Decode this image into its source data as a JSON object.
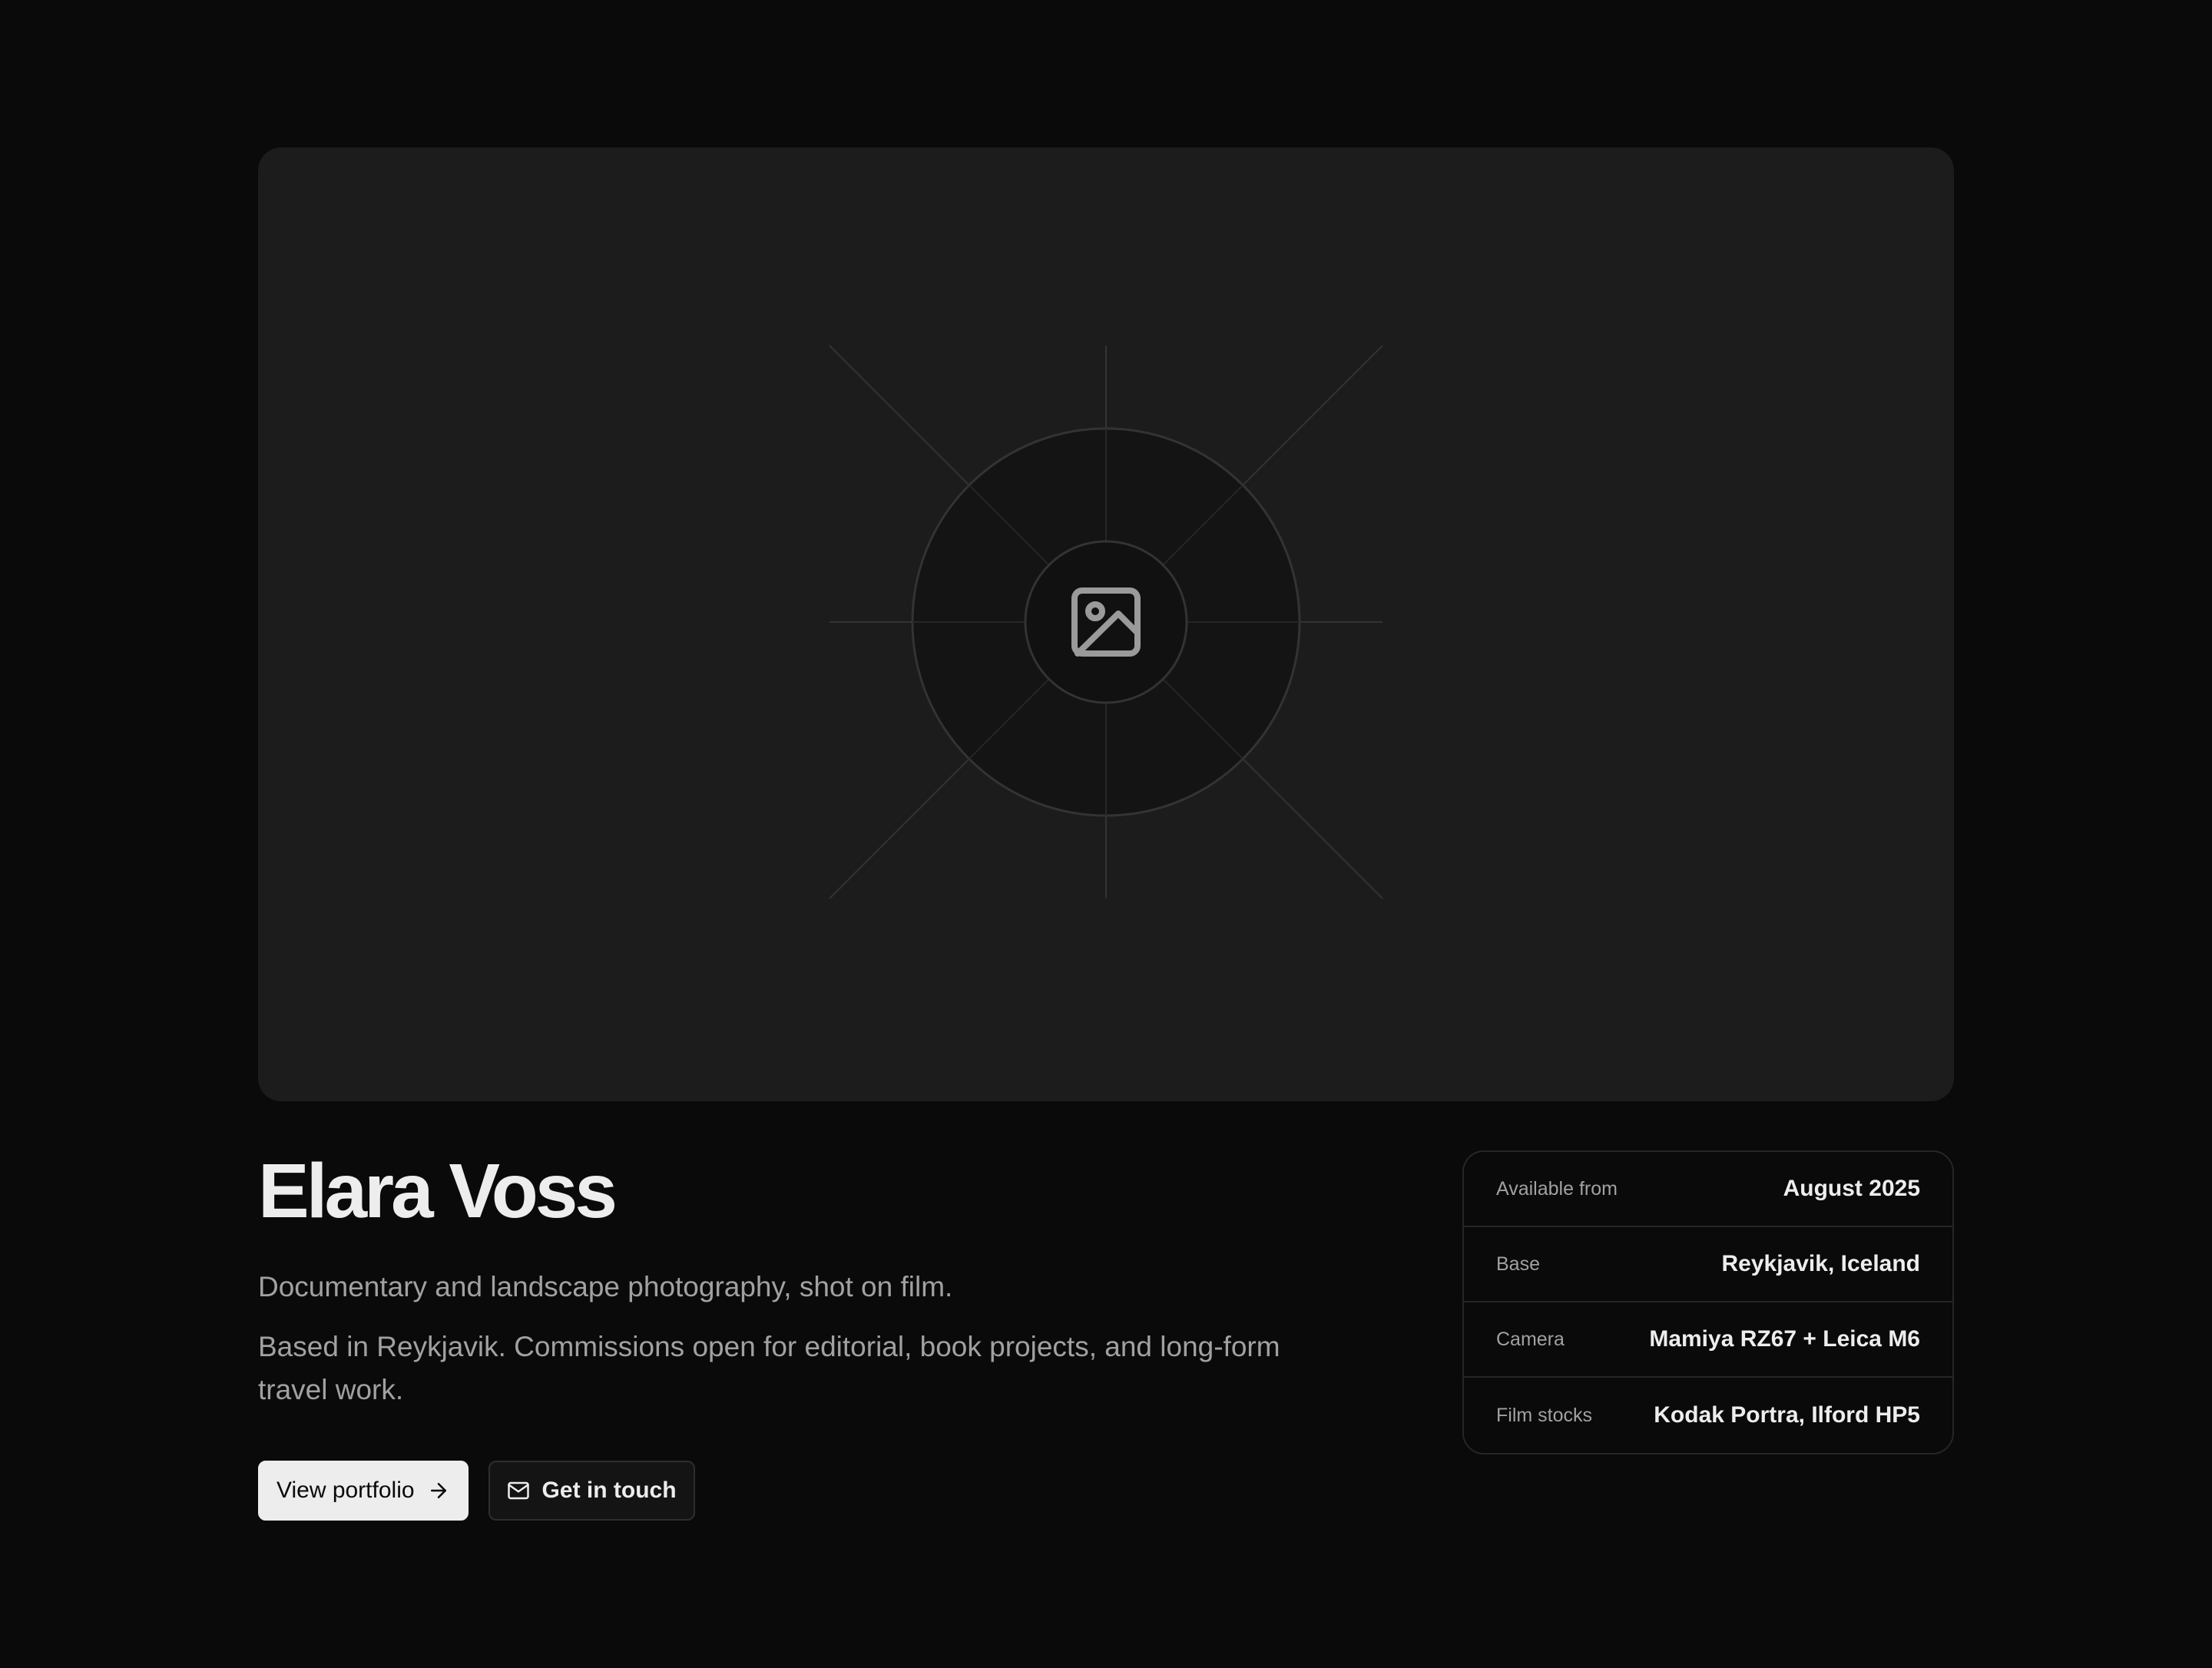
{
  "profile": {
    "name": "Elara Voss",
    "tagline": "Documentary and landscape photography, shot on film.",
    "description": "Based in Reykjavik. Commissions open for editorial, book projects, and long-form travel work."
  },
  "actions": {
    "primary_label": "View portfolio",
    "secondary_label": "Get in touch"
  },
  "details": [
    {
      "label": "Available from",
      "value": "August 2025"
    },
    {
      "label": "Base",
      "value": "Reykjavik, Iceland"
    },
    {
      "label": "Camera",
      "value": "Mamiya RZ67 + Leica M6"
    },
    {
      "label": "Film stocks",
      "value": "Kodak Portra, Ilford HP5"
    }
  ],
  "icons": {
    "hero": "image-placeholder-icon",
    "primary_action": "arrow-right-icon",
    "secondary_action": "mail-icon"
  },
  "colors": {
    "background": "#0a0a0a",
    "surface": "#1c1c1c",
    "text": "#ededed",
    "muted": "#a1a1a1",
    "border": "#262626"
  }
}
